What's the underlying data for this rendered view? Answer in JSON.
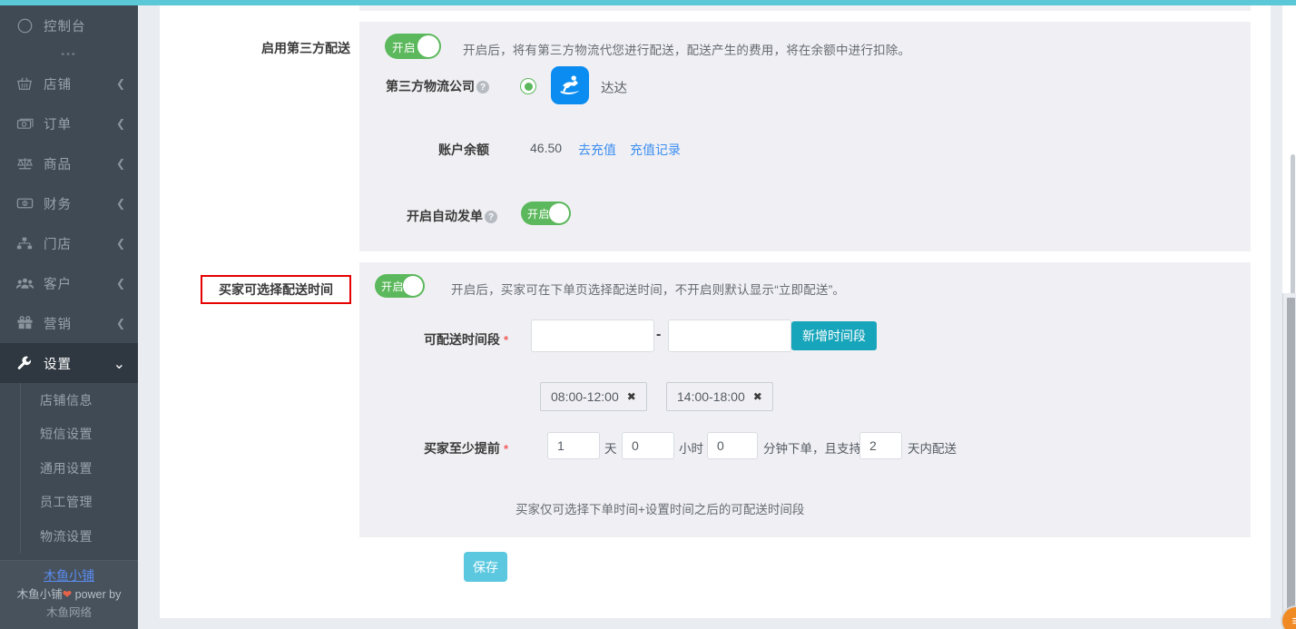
{
  "sidebar": {
    "items": [
      {
        "label": "控制台",
        "icon": "compass-icon",
        "arrow": ""
      },
      {
        "label": "店铺",
        "icon": "basket-icon",
        "arrow": "❮"
      },
      {
        "label": "订单",
        "icon": "money-icon",
        "arrow": "❮"
      },
      {
        "label": "商品",
        "icon": "scale-icon",
        "arrow": "❮"
      },
      {
        "label": "财务",
        "icon": "banknote-icon",
        "arrow": "❮"
      },
      {
        "label": "门店",
        "icon": "sitemap-icon",
        "arrow": "❮"
      },
      {
        "label": "客户",
        "icon": "users-icon",
        "arrow": "❮"
      },
      {
        "label": "营销",
        "icon": "gift-icon",
        "arrow": "❮"
      },
      {
        "label": "设置",
        "icon": "wrench-icon",
        "arrow": "⌄"
      }
    ],
    "dots": "•••",
    "subitems": [
      {
        "label": "店铺信息"
      },
      {
        "label": "短信设置"
      },
      {
        "label": "通用设置"
      },
      {
        "label": "员工管理"
      },
      {
        "label": "物流设置"
      }
    ],
    "footer": {
      "shop_link": "木鱼小铺",
      "power_prefix": "木鱼小铺",
      "power_heart": "❤",
      "power_suffix": " power by",
      "power_line2": "木鱼网络"
    }
  },
  "third_party": {
    "label": "启用第三方配送",
    "toggle_text": "开启",
    "description": "开启后，将有第三方物流代您进行配送，配送产生的费用，将在余额中进行扣除。",
    "company_label": "第三方物流公司",
    "company_help": "?",
    "company_name": "达达",
    "balance_label": "账户余额",
    "balance_value": "46.50",
    "recharge_link": "去充值",
    "records_link": "充值记录",
    "auto_dispatch_label": "开启自动发单",
    "auto_dispatch_help": "?",
    "auto_dispatch_toggle": "开启"
  },
  "buyer_time": {
    "label": "买家可选择配送时间",
    "toggle_text": "开启",
    "description": "开启后，买家可在下单页选择配送时间，不开启则默认显示“立即配送”。",
    "slot_label": "可配送时间段",
    "slot_required": "*",
    "slot_start_value": "",
    "slot_end_value": "",
    "slot_separator": "-",
    "add_slot_button": "新增时间段",
    "tags": [
      {
        "text": "08:00-12:00",
        "close": "✖"
      },
      {
        "text": "14:00-18:00",
        "close": "✖"
      }
    ],
    "advance_label": "买家至少提前",
    "advance_required": "*",
    "days_value": "1",
    "days_unit": "天",
    "hours_value": "0",
    "hours_unit": "小时",
    "minutes_value": "0",
    "minutes_unit": "分钟下单，且支持",
    "support_days_value": "2",
    "support_days_unit": "天内配送",
    "hint": "买家仅可选择下单时间+设置时间之后的可配送时间段"
  },
  "actions": {
    "save_button": "保存"
  },
  "fab": {
    "label": "≡"
  },
  "colors": {
    "accent_top": "#5bc8d8",
    "sidebar_bg": "#3f4a55",
    "sidebar_active": "#2f3841",
    "toggle_on": "#5cb85c",
    "link_blue": "#3d8ef0",
    "button_teal": "#17a5bb",
    "save_cyan": "#5bc8e0",
    "dada_blue": "#0b8cf0",
    "highlight_red": "#e60000",
    "panel_grey": "#f0f0f4"
  }
}
